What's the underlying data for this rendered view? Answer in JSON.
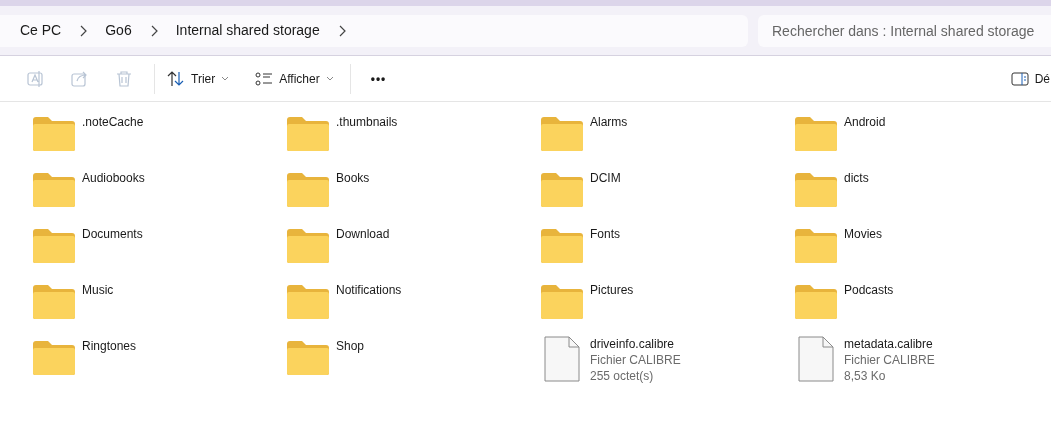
{
  "breadcrumb": [
    "Ce PC",
    "Go6",
    "Internal shared storage"
  ],
  "search": {
    "placeholder": "Rechercher dans : Internal shared storage"
  },
  "toolbar": {
    "actions": [
      {
        "kind": "rename",
        "disabled": true
      },
      {
        "kind": "share",
        "disabled": true
      },
      {
        "kind": "delete",
        "disabled": true
      }
    ],
    "sort": {
      "label": "Trier"
    },
    "view": {
      "label": "Afficher"
    },
    "more": {
      "label": "•••"
    },
    "details": {
      "label": "Dé"
    }
  },
  "items": [
    {
      "kind": "folder",
      "name": ".noteCache"
    },
    {
      "kind": "folder",
      "name": ".thumbnails"
    },
    {
      "kind": "folder",
      "name": "Alarms"
    },
    {
      "kind": "folder",
      "name": "Android"
    },
    {
      "kind": "folder",
      "name": "Audiobooks"
    },
    {
      "kind": "folder",
      "name": "Books"
    },
    {
      "kind": "folder",
      "name": "DCIM"
    },
    {
      "kind": "folder",
      "name": "dicts"
    },
    {
      "kind": "folder",
      "name": "Documents"
    },
    {
      "kind": "folder",
      "name": "Download"
    },
    {
      "kind": "folder",
      "name": "Fonts"
    },
    {
      "kind": "folder",
      "name": "Movies"
    },
    {
      "kind": "folder",
      "name": "Music"
    },
    {
      "kind": "folder",
      "name": "Notifications"
    },
    {
      "kind": "folder",
      "name": "Pictures"
    },
    {
      "kind": "folder",
      "name": "Podcasts"
    },
    {
      "kind": "folder",
      "name": "Ringtones"
    },
    {
      "kind": "folder",
      "name": "Shop"
    },
    {
      "kind": "file",
      "name": "driveinfo.calibre",
      "type": "Fichier CALIBRE",
      "size": "255 octet(s)"
    },
    {
      "kind": "file",
      "name": "metadata.calibre",
      "type": "Fichier CALIBRE",
      "size": "8,53 Ko"
    }
  ]
}
